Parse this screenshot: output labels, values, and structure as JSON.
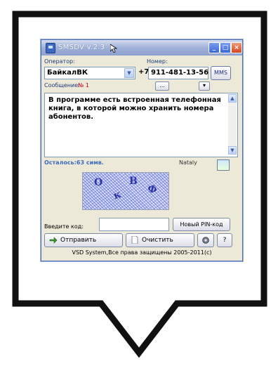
{
  "window": {
    "title": "SMSDV v.2.3"
  },
  "operator": {
    "label": "Оператор:",
    "value": "БайкалВК"
  },
  "number": {
    "label": "Номер:",
    "prefix": "+7",
    "value": "911-481-13-56",
    "mms_label": "MMS"
  },
  "message": {
    "label": "Сообщение:",
    "index": "№ 1",
    "text": "В программе есть встроенная телефонная книга, в которой можно хранить номера абонентов.",
    "picker_label": "...",
    "small_dropdown": "▾"
  },
  "status": {
    "remaining": "Осталось:63 симв.",
    "user": "Nataly"
  },
  "captcha": {
    "chars": [
      "О",
      "к",
      "В",
      "Ф"
    ]
  },
  "pin": {
    "label": "Введите код:",
    "value": "",
    "new_pin_label": "Новый PIN-код"
  },
  "actions": {
    "send": "Отправить",
    "clear": "Очистить",
    "help": "?"
  },
  "footer": "VSD System,Все права защищены 2005-2011(c)",
  "colors": {
    "titlebar_start": "#d8ddef",
    "window_bg": "#ece9d8",
    "accent_blue": "#3b6cc0",
    "message_index_red": "#c0001a"
  }
}
